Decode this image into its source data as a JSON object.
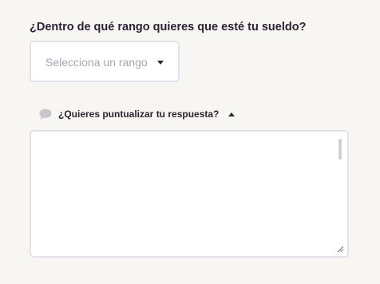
{
  "salary_question": {
    "label": "¿Dentro de qué rango quieres que esté tu sueldo?",
    "select_placeholder": "Selecciona un rango",
    "caret_icon": "chevron-down-icon"
  },
  "details": {
    "toggle_label": "¿Quieres puntualizar tu respuesta?",
    "comment_icon": "comment-bubble-icon",
    "toggle_icon": "chevron-up-icon",
    "expanded": true,
    "textarea_value": ""
  },
  "colors": {
    "background": "#f7f6f3",
    "text": "#2b2233",
    "placeholder": "#a9a4b0",
    "border": "#e4e1ea",
    "icon_gray": "#c8c6cc"
  }
}
